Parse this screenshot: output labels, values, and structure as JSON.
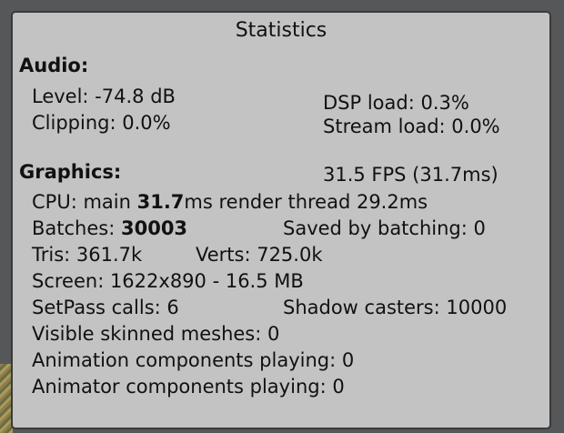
{
  "window": {
    "title": "Statistics"
  },
  "audio": {
    "header": "Audio:",
    "level": "Level: -74.8 dB",
    "clipping": "Clipping: 0.0%",
    "dsp_load": "DSP load: 0.3%",
    "stream_load": "Stream load: 0.0%"
  },
  "graphics": {
    "header": "Graphics:",
    "fps": "31.5 FPS (31.7ms)",
    "cpu_prefix": "CPU: main ",
    "cpu_main_value": "31.7",
    "cpu_suffix": "ms  render thread 29.2ms",
    "batches_prefix": "Batches: ",
    "batches_value": "30003",
    "saved_by_batching": "Saved by batching: 0",
    "tris": "Tris: 361.7k",
    "verts": "Verts: 725.0k",
    "screen": "Screen: 1622x890 - 16.5 MB",
    "setpass_calls": "SetPass calls: 6",
    "shadow_casters": "Shadow casters: 10000",
    "visible_skinned_meshes": "Visible skinned meshes: 0",
    "animation_components": "Animation components playing: 0",
    "animator_components": "Animator components playing: 0"
  }
}
